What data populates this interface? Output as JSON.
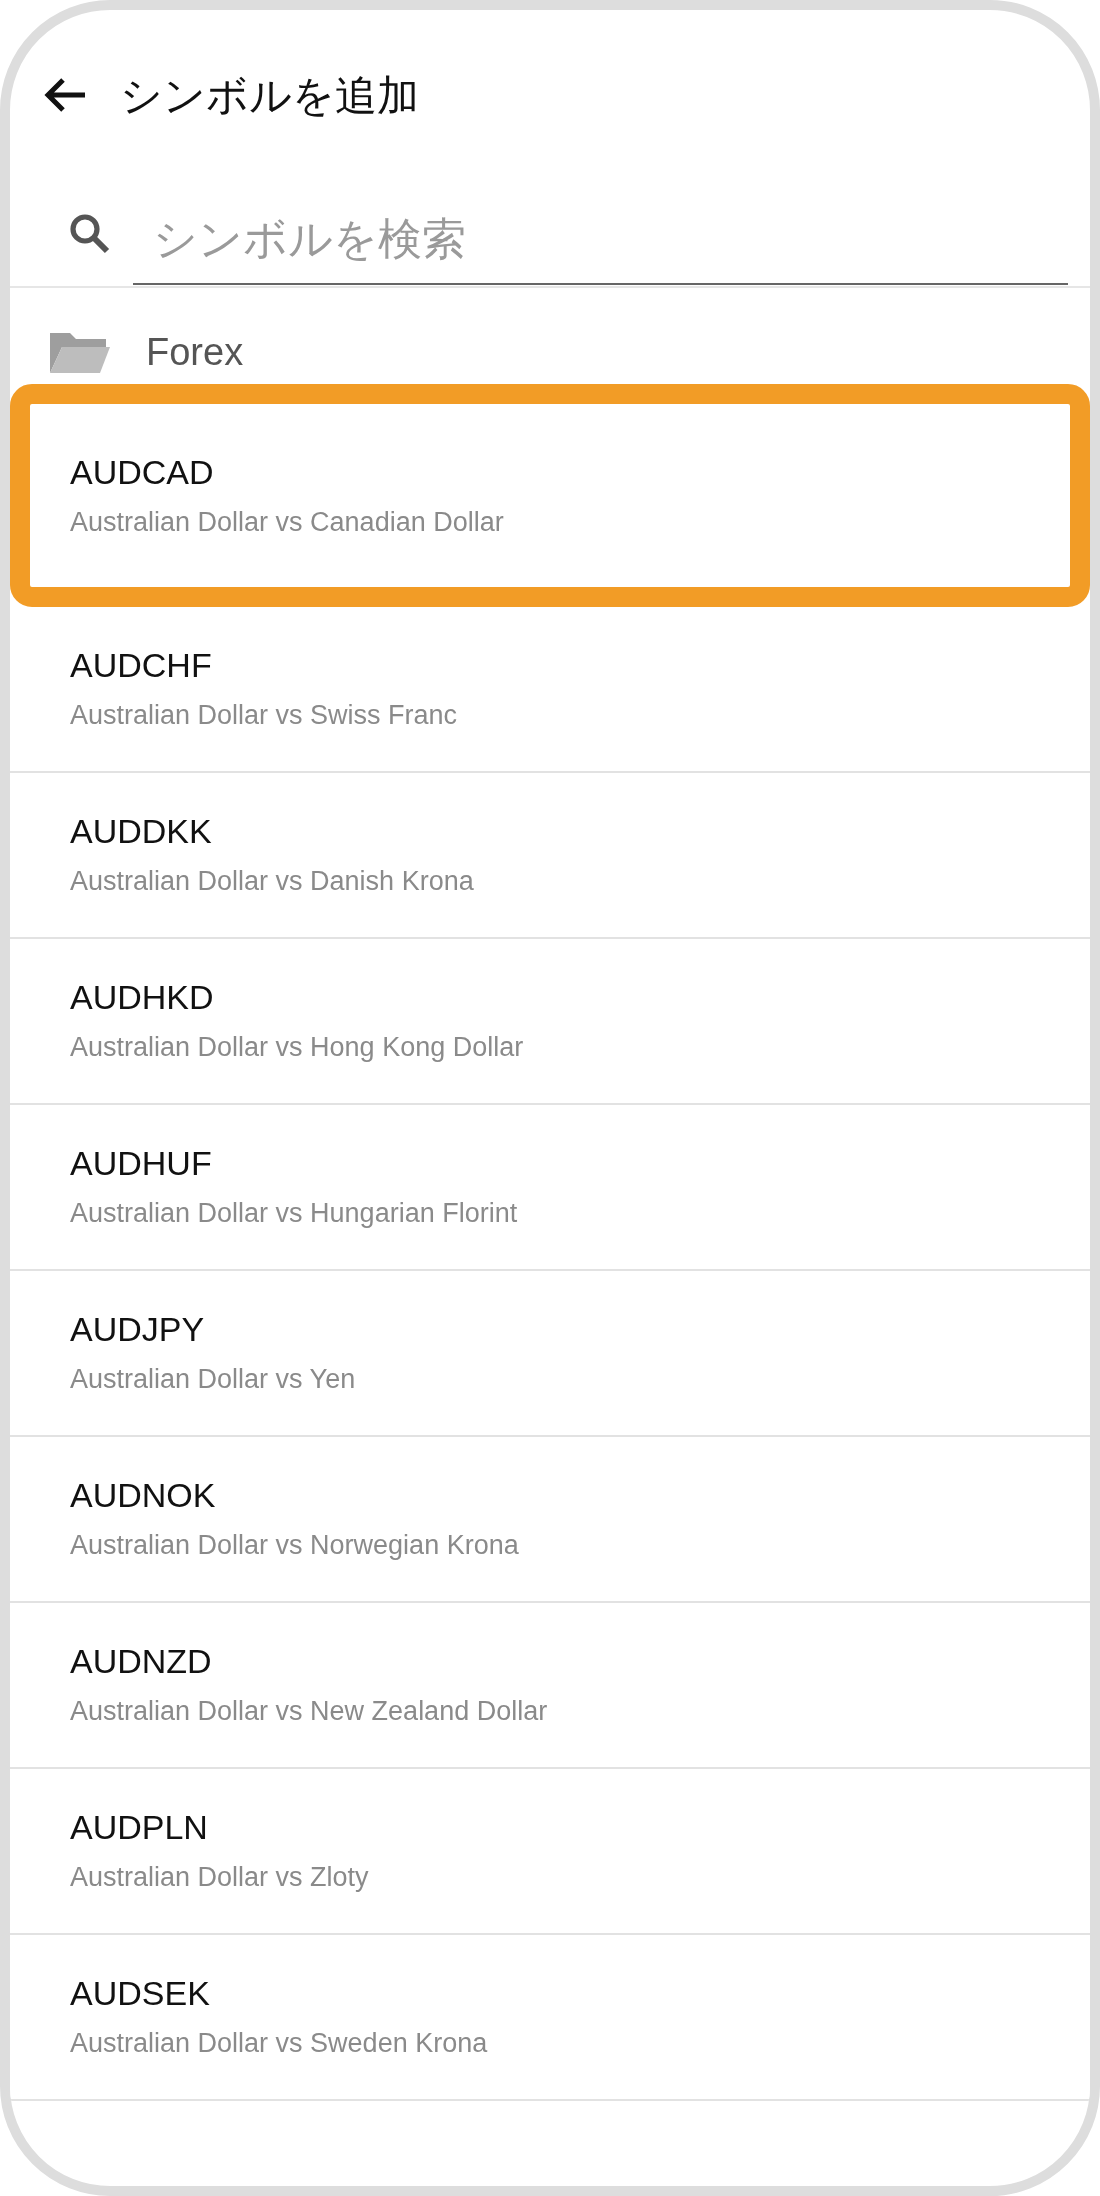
{
  "header": {
    "title": "シンボルを追加"
  },
  "search": {
    "placeholder": "シンボルを検索"
  },
  "folder": {
    "name": "Forex"
  },
  "symbols": [
    {
      "symbol": "AUDCAD",
      "description": "Australian Dollar vs Canadian Dollar",
      "selected": true
    },
    {
      "symbol": "AUDCHF",
      "description": "Australian Dollar vs Swiss Franc",
      "selected": false
    },
    {
      "symbol": "AUDDKK",
      "description": "Australian Dollar vs Danish Krona",
      "selected": false
    },
    {
      "symbol": "AUDHKD",
      "description": "Australian Dollar vs Hong Kong Dollar",
      "selected": false
    },
    {
      "symbol": "AUDHUF",
      "description": "Australian Dollar vs Hungarian Florint",
      "selected": false
    },
    {
      "symbol": "AUDJPY",
      "description": "Australian Dollar vs Yen",
      "selected": false
    },
    {
      "symbol": "AUDNOK",
      "description": "Australian Dollar vs Norwegian Krona",
      "selected": false
    },
    {
      "symbol": "AUDNZD",
      "description": "Australian Dollar vs New Zealand Dollar",
      "selected": false
    },
    {
      "symbol": "AUDPLN",
      "description": "Australian Dollar vs Zloty",
      "selected": false
    },
    {
      "symbol": "AUDSEK",
      "description": "Australian Dollar vs Sweden Krona",
      "selected": false
    }
  ]
}
